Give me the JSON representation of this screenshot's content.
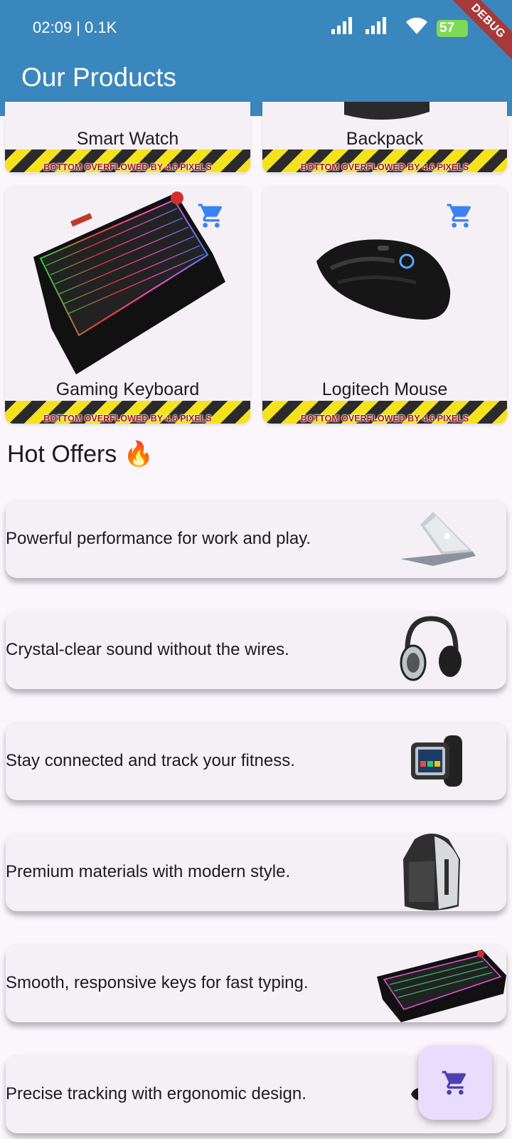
{
  "status_bar": {
    "time": "02:09 | 0.1K",
    "battery": "57"
  },
  "app_bar": {
    "title": "Our Products",
    "debug_banner": "DEBUG"
  },
  "products": [
    {
      "name": "Smart Watch",
      "overflow_label": "BOTTOM OVERFLOWED BY 4.6 PIXELS"
    },
    {
      "name": "Backpack",
      "overflow_label": "BOTTOM OVERFLOWED BY 4.6 PIXELS"
    },
    {
      "name": "Gaming Keyboard",
      "overflow_label": "BOTTOM OVERFLOWED BY 4.6 PIXELS"
    },
    {
      "name": "Logitech Mouse",
      "overflow_label": "BOTTOM OVERFLOWED BY 4.6 PIXELS"
    }
  ],
  "hot_offers": {
    "title": "Hot Offers 🔥",
    "items": [
      {
        "text": "Powerful performance for work and play.",
        "icon": "laptop"
      },
      {
        "text": "Crystal-clear sound without the wires.",
        "icon": "headphones"
      },
      {
        "text": "Stay connected and track your fitness.",
        "icon": "smartwatch"
      },
      {
        "text": "Premium materials with modern style.",
        "icon": "backpack"
      },
      {
        "text": "Smooth, responsive keys for fast typing.",
        "icon": "keyboard"
      },
      {
        "text": "Precise tracking with ergonomic design.",
        "icon": "mouse"
      }
    ]
  },
  "colors": {
    "app_bar": "#3a87bd",
    "cart_icon": "#3b82f6",
    "fab_bg": "#e9ddfe",
    "fab_icon": "#4f3fb0"
  }
}
